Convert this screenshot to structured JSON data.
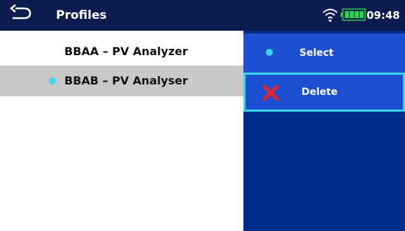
{
  "header": {
    "title": "Profiles",
    "time": "09:48",
    "back_icon": "back-arrow-icon",
    "wifi_icon": "wifi-icon",
    "battery_icon": "battery-full-icon"
  },
  "profiles": [
    {
      "label": "BBAA – PV Analyzer",
      "active": false,
      "selected": false
    },
    {
      "label": "BBAB – PV Analyser",
      "active": true,
      "selected": true
    }
  ],
  "menu": {
    "items": [
      {
        "label": "Select",
        "icon": "dot-icon"
      },
      {
        "label": "Delete",
        "icon": "red-x-icon",
        "focused": true
      }
    ]
  },
  "colors": {
    "header_bg": "#0c1c4f",
    "panel_bg": "#002d8a",
    "menu_item_bg": "#1a50d1",
    "accent": "#3ad8ee",
    "delete_red": "#e8222a",
    "selected_row_bg": "#c8c8c8"
  }
}
